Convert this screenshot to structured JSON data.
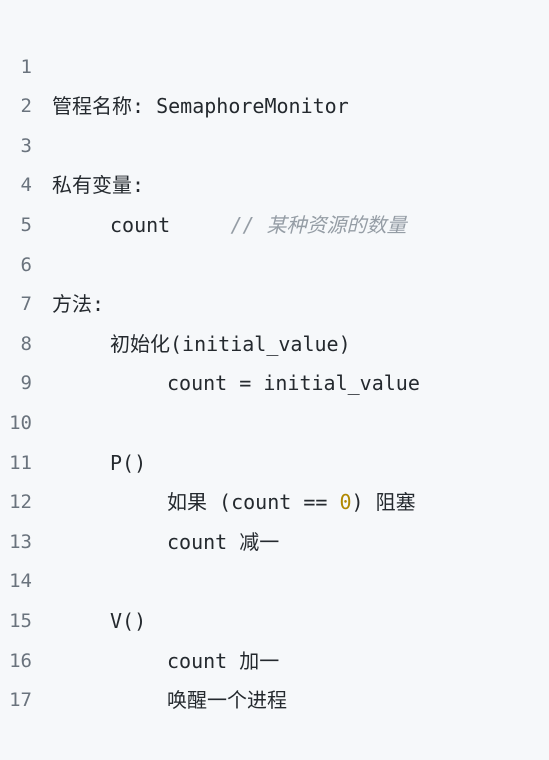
{
  "code": {
    "line_numbers": [
      "1",
      "2",
      "3",
      "4",
      "5",
      "6",
      "7",
      "8",
      "9",
      "10",
      "11",
      "12",
      "13",
      "14",
      "15",
      "16",
      "17"
    ],
    "l1": "管程名称: SemaphoreMonitor",
    "l3": "私有变量:",
    "l4_code": "count",
    "l4_comment": "// 某种资源的数量",
    "l6": "方法:",
    "l7": "初始化(initial_value)",
    "l8": "count = initial_value",
    "l10": "P()",
    "l11_a": "如果 (count == ",
    "l11_num": "0",
    "l11_b": ") 阻塞",
    "l12": "count 减一",
    "l14": "V()",
    "l15": "count 加一",
    "l16": "唤醒一个进程"
  },
  "colors": {
    "background": "#f6f8fa",
    "text": "#24292e",
    "line_number": "#6a737d",
    "comment": "#959da5",
    "number": "#b08800"
  }
}
